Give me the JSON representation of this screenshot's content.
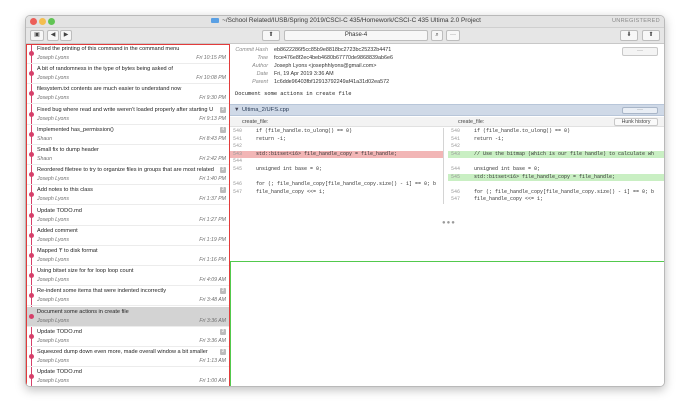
{
  "window": {
    "title": "~/School Related/IUSB/Spring 2019/CSCI-C 435/Homework/CSCI-C 435 Ultima 2.0 Project",
    "unregistered": "UNREGISTERED"
  },
  "toolbar": {
    "branch": "Phase-4",
    "back": "◀",
    "forward": "▶",
    "sidebar_toggle": "▣",
    "stash": "⬆",
    "search": "⌕",
    "more": "···",
    "pull": "⬇",
    "push": "⬆"
  },
  "commits": [
    {
      "message": "Fixed the printing of this command in the command menu",
      "author": "Joseph Lyons",
      "date": "Fri 10:15 PM",
      "badge": ""
    },
    {
      "message": "A bit of randomness in the type of bytes being asked of",
      "author": "Joseph Lyons",
      "date": "Fri 10:08 PM",
      "badge": ""
    },
    {
      "message": "filesystem.txt contents are much easier to understand now",
      "author": "Joseph Lyons",
      "date": "Fri 9:30 PM",
      "badge": ""
    },
    {
      "message": "Fixed bug where read and write weren't loaded properly after starting U",
      "author": "Joseph Lyons",
      "date": "Fri 9:13 PM",
      "badge": "2"
    },
    {
      "message": "Implemented has_permission()",
      "author": "Shaun",
      "date": "Fri 8:43 PM",
      "badge": "4"
    },
    {
      "message": "Small fix to dump header",
      "author": "Shaun",
      "date": "Fri 2:42 PM",
      "badge": ""
    },
    {
      "message": "Reordered filetree to try to organize files in groups that are most related",
      "author": "Joseph Lyons",
      "date": "Fri 1:40 PM",
      "badge": "2"
    },
    {
      "message": "Add notes to this class",
      "author": "Joseph Lyons",
      "date": "Fri 1:37 PM",
      "badge": "2"
    },
    {
      "message": "Update TODO.md",
      "author": "Joseph Lyons",
      "date": "Fri 1:27 PM",
      "badge": ""
    },
    {
      "message": "Added comment",
      "author": "Joseph Lyons",
      "date": "Fri 1:19 PM",
      "badge": ""
    },
    {
      "message": "Mapped 'f' to disk format",
      "author": "Joseph Lyons",
      "date": "Fri 1:16 PM",
      "badge": ""
    },
    {
      "message": "Using bitset size for for loop loop count",
      "author": "Joseph Lyons",
      "date": "Fri 4:09 AM",
      "badge": ""
    },
    {
      "message": "Re-indent some items that were indented incorrectly",
      "author": "Joseph Lyons",
      "date": "Fri 3:48 AM",
      "badge": "2"
    },
    {
      "message": "Document some actions in create file",
      "author": "Joseph Lyons",
      "date": "Fri 3:36 AM",
      "badge": "",
      "selected": true
    },
    {
      "message": "Update TODO.md",
      "author": "Joseph Lyons",
      "date": "Fri 3:36 AM",
      "badge": "2"
    },
    {
      "message": "Squeezed dump down even more, made overall window a bit smaller",
      "author": "Joseph Lyons",
      "date": "Fri 1:13 AM",
      "badge": "2"
    },
    {
      "message": "Update TODO.md",
      "author": "Joseph Lyons",
      "date": "Fri 1:00 AM",
      "badge": ""
    }
  ],
  "detail": {
    "commit_hash_label": "Commit Hash",
    "commit_hash": "eb8622286f5cc85b9e8818bc2723bc25232b4471",
    "tree_label": "Tree",
    "tree": "fcce476e8f2ec4beb4680b67770de9868839ab6e6",
    "author_label": "Author",
    "author": "Joseph Lyons <josephhlyons@gmail.com>",
    "date_label": "Date",
    "date": "Fri, 19 Apr 2019 3:36 AM",
    "parent_label": "Parent",
    "parent": "1c6dde96403fbf12913792249af41a31d02ea572",
    "summary": "Document some actions in create file",
    "more_button": "···"
  },
  "file": {
    "name": "Ultima_2/UFS.cpp",
    "more_button": "···",
    "left_header": "create_file:",
    "right_header": "create_file:",
    "hunk_button": "Hunk history",
    "left_lines": [
      {
        "n": "540",
        "code": "if (file_handle.to_ulong() == 0)",
        "type": ""
      },
      {
        "n": "541",
        "code": "    return -1;",
        "type": ""
      },
      {
        "n": "542",
        "code": "",
        "type": ""
      },
      {
        "n": "543",
        "code": "std::bitset<16> file_handle_copy = file_handle;",
        "type": "del"
      },
      {
        "n": "544",
        "code": "",
        "type": ""
      },
      {
        "n": "545",
        "code": "unsigned int base = 0;",
        "type": ""
      },
      {
        "n": "",
        "code": "",
        "type": ""
      },
      {
        "n": "546",
        "code": "for (; file_handle_copy[file_handle_copy.size() - 1] == 0; b",
        "type": ""
      },
      {
        "n": "547",
        "code": "    file_handle_copy <<= 1;",
        "type": ""
      }
    ],
    "right_lines": [
      {
        "n": "540",
        "code": "if (file_handle.to_ulong() == 0)",
        "type": ""
      },
      {
        "n": "541",
        "code": "    return -1;",
        "type": ""
      },
      {
        "n": "542",
        "code": "",
        "type": ""
      },
      {
        "n": "543",
        "code": "// Use the bitmap (which is our file handle) to calculate wh",
        "type": "add"
      },
      {
        "n": "",
        "code": "",
        "type": ""
      },
      {
        "n": "544",
        "code": "unsigned int base = 0;",
        "type": ""
      },
      {
        "n": "545",
        "code": "std::bitset<16> file_handle_copy = file_handle;",
        "type": "add"
      },
      {
        "n": "",
        "code": "",
        "type": ""
      },
      {
        "n": "546",
        "code": "for (; file_handle_copy[file_handle_copy.size() - 1] == 0; b",
        "type": ""
      },
      {
        "n": "547",
        "code": "    file_handle_copy <<= 1;",
        "type": ""
      }
    ],
    "ellipsis": "●●●"
  },
  "colors": {
    "graph": "#d6406a",
    "red_frame": "#e23b3b",
    "green_frame": "#52c94d",
    "deleted": "#f2b6b6",
    "added": "#c9efc3"
  }
}
